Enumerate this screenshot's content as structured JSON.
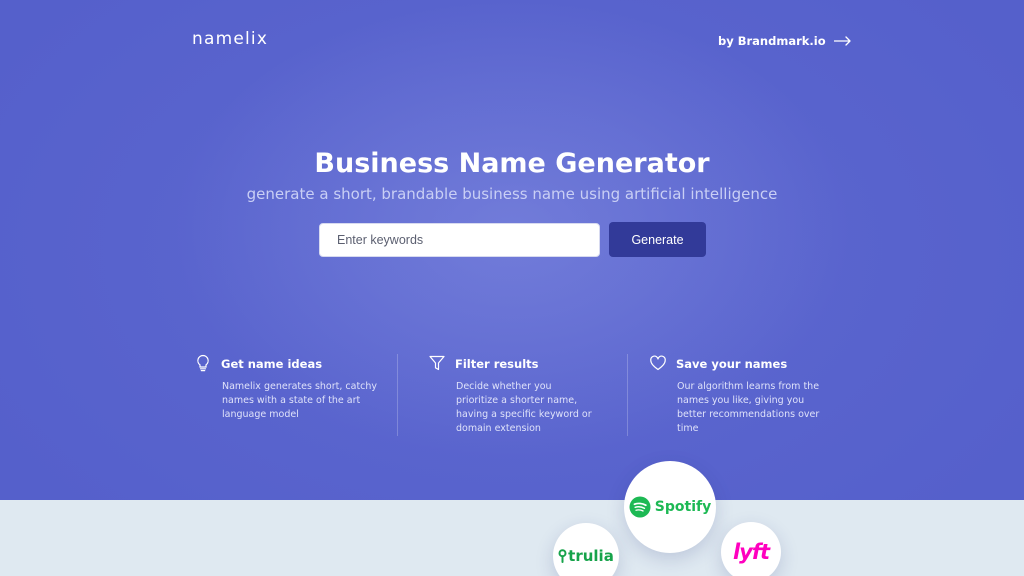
{
  "header": {
    "logo": "namelix",
    "by_link": "by Brandmark.io"
  },
  "hero": {
    "title": "Business Name Generator",
    "subtitle": "generate a short, brandable business name using artificial intelligence",
    "search_placeholder": "Enter keywords",
    "generate_label": "Generate"
  },
  "features": [
    {
      "icon": "lightbulb-icon",
      "title": "Get name ideas",
      "desc": "Namelix generates short, catchy names with a state of the art language model"
    },
    {
      "icon": "filter-icon",
      "title": "Filter results",
      "desc": "Decide whether you prioritize a shorter name, having a specific keyword or domain extension"
    },
    {
      "icon": "heart-icon",
      "title": "Save your names",
      "desc": "Our algorithm learns from the names you like, giving you better recommendations over time"
    }
  ],
  "brands": {
    "spotify": "Spotify",
    "trulia": "trulia",
    "lyft": "lyft"
  },
  "colors": {
    "hero_bg": "#5560cb",
    "button_bg": "#323a99",
    "lower_bg": "#dfe9f1",
    "spotify_green": "#1db954",
    "lyft_pink": "#ff00bf",
    "trulia_green": "#16a34a"
  }
}
